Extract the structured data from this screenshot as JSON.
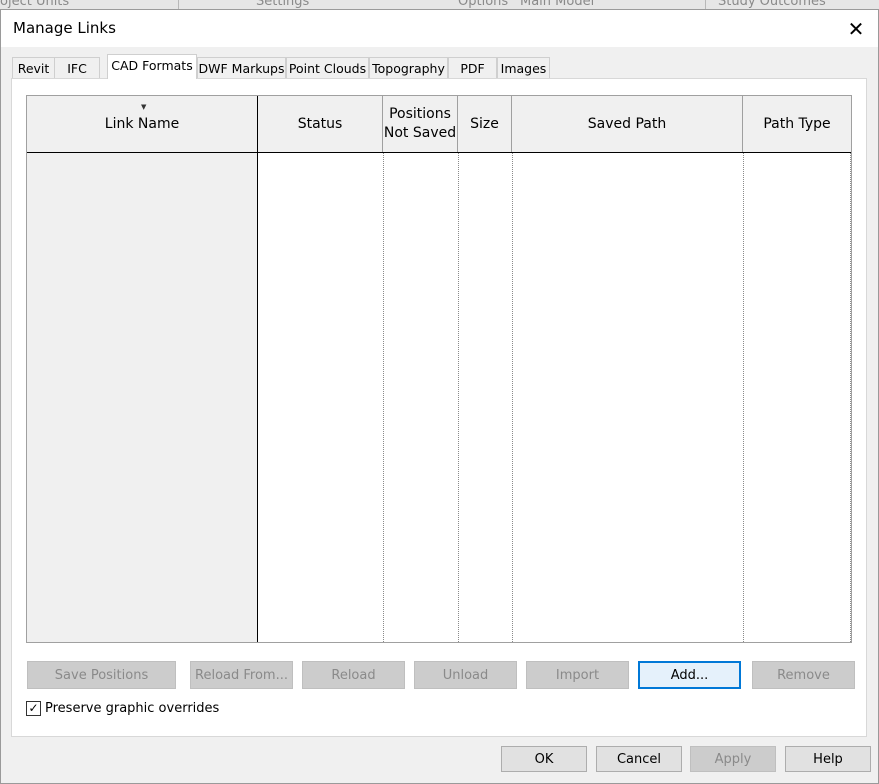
{
  "background": {
    "items": [
      "oject Units",
      "Settings",
      "Options",
      "Main Model",
      "Study Outcomes"
    ]
  },
  "dialog": {
    "title": "Manage Links",
    "close_glyph": "✕"
  },
  "tabs": [
    {
      "label": "Revit"
    },
    {
      "label": "IFC"
    },
    {
      "label": "CAD Formats"
    },
    {
      "label": "DWF Markups"
    },
    {
      "label": "Point Clouds"
    },
    {
      "label": "Topography"
    },
    {
      "label": "PDF"
    },
    {
      "label": "Images"
    }
  ],
  "active_tab": "CAD Formats",
  "table": {
    "columns": [
      {
        "label": "Link Name"
      },
      {
        "label": "Status"
      },
      {
        "label": "Positions Not Saved"
      },
      {
        "label": "Size"
      },
      {
        "label": "Saved Path"
      },
      {
        "label": "Path Type"
      }
    ],
    "rows": []
  },
  "actions": {
    "save_positions": "Save Positions",
    "reload_from": "Reload From...",
    "reload": "Reload",
    "unload": "Unload",
    "import": "Import",
    "add": "Add...",
    "remove": "Remove"
  },
  "preserve_overrides": {
    "label": "Preserve graphic overrides",
    "checked": true
  },
  "footer": {
    "ok": "OK",
    "cancel": "Cancel",
    "apply": "Apply",
    "help": "Help"
  },
  "colors": {
    "focus_border": "#0078d7",
    "disabled_text": "#8a8a8a"
  }
}
